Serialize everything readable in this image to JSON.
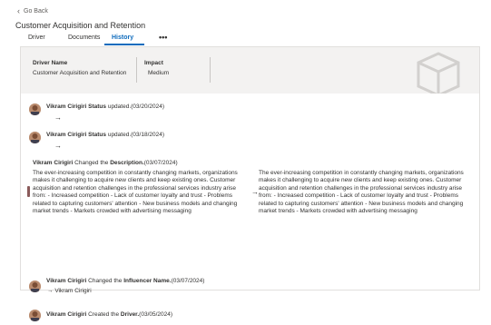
{
  "nav": {
    "back_label": "Go Back",
    "back_icon": "chevron-left-icon"
  },
  "page": {
    "title": "Customer Acquisition and Retention"
  },
  "tabs": [
    {
      "label": "Driver",
      "active": false
    },
    {
      "label": "Documents",
      "active": false
    },
    {
      "label": "History",
      "active": true
    }
  ],
  "more_label": "•••",
  "summary": {
    "driver_name_label": "Driver Name",
    "driver_name_value": "Customer Acquisition and Retention",
    "impact_label": "Impact",
    "impact_value": "Medium",
    "illustration_icon": "cube-icon"
  },
  "history": [
    {
      "user": "Vikram Cirigiri",
      "action_prefix": "",
      "field": "Status",
      "action_suffix": "updated.",
      "date": "(03/20/2024)",
      "arrow": "→",
      "new_value": ""
    },
    {
      "user": "Vikram Cirigiri",
      "action_prefix": "",
      "field": "Status",
      "action_suffix": "updated.",
      "date": "(03/18/2024)",
      "arrow": "→",
      "new_value": ""
    },
    {
      "user": "Vikram Cirigiri",
      "action_prefix": "Changed the",
      "field": "Description.",
      "date": "(03/07/2024)",
      "arrow": "→",
      "old_text": "The ever-increasing competition in constantly changing markets, organizations makes it challenging to acquire new clients and keep existing ones. Customer acquisition and retention challenges in the professional services industry arise from: - Increased competition - Lack of customer loyalty and trust - Problems related to capturing customers' attention - New business models and changing market trends - Markets crowded with advertising messaging",
      "new_text": "The ever-increasing competition in constantly changing markets, organizations makes it challenging to acquire new clients and keep existing ones. Customer acquisition and retention challenges in the professional services industry arise from: - Increased competition - Lack of customer loyalty and trust - Problems related to capturing customers' attention - New business models and changing market trends - Markets crowded with advertising messaging"
    },
    {
      "user": "Vikram Cirigiri",
      "action_prefix": "Changed the",
      "field": "Influencer Name.",
      "date": "(03/07/2024)",
      "arrow": "→",
      "new_value": "Vikram Cirigiri"
    },
    {
      "user": "Vikram Cirigiri",
      "action_prefix": "Created the",
      "field": "Driver.",
      "date": "(03/05/2024)"
    }
  ]
}
